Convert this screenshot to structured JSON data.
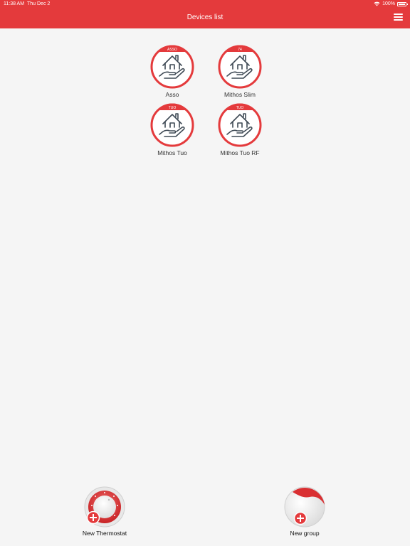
{
  "status_bar": {
    "time": "11:38 AM",
    "date": "Thu Dec 2",
    "battery": "100%"
  },
  "header": {
    "title": "Devices list",
    "menu_icon": "hamburger-menu-icon"
  },
  "devices": [
    {
      "label": "Asso",
      "badge": "ASSO",
      "icon": "house-in-hand-icon"
    },
    {
      "label": "Mithos Slim",
      "badge": "74",
      "icon": "house-in-hand-icon"
    },
    {
      "label": "Mithos Tuo",
      "badge": "TUO",
      "icon": "house-in-hand-icon"
    },
    {
      "label": "Mithos Tuo RF",
      "badge": "TUO",
      "icon": "house-in-hand-icon"
    }
  ],
  "actions": {
    "new_thermostat": "New Thermostat",
    "new_group": "New group"
  },
  "colors": {
    "brand_red": "#e43a3c",
    "background": "#f5f5f5"
  }
}
